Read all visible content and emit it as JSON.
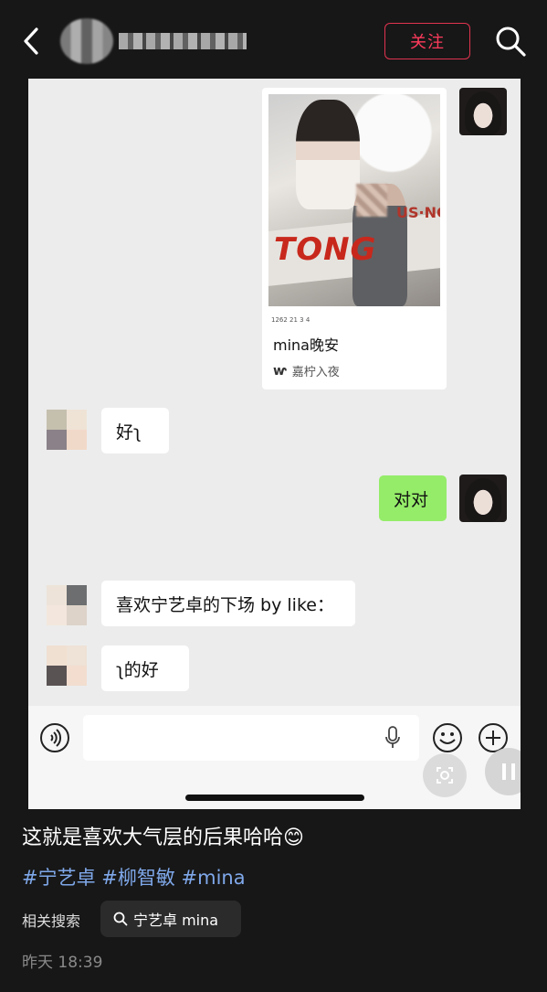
{
  "header": {
    "follow_label": "关注"
  },
  "chat": {
    "shared_card": {
      "photo_text_1": "TONG",
      "photo_text_2": "US·NC",
      "stats": "1262  21  3  4",
      "title": "mina晚安",
      "author": "嘉柠入夜"
    },
    "messages": [
      {
        "side": "left",
        "text": "好ʅ"
      },
      {
        "side": "right",
        "text": "对对"
      },
      {
        "side": "left",
        "text": "喜欢宁艺卓的下场 by like："
      },
      {
        "side": "left",
        "text": "ʅ的好"
      }
    ]
  },
  "post": {
    "caption": "这就是喜欢大气层的后果哈哈😊",
    "tags": "#宁艺卓 #柳智敏 #mina",
    "related_label": "相关搜索",
    "related_query": "宁艺卓 mina",
    "time": "昨天 18:39"
  },
  "colors": {
    "accent_red": "#ff3b5c",
    "tag_blue": "#7fa8ea",
    "bubble_green": "#95ec69"
  }
}
